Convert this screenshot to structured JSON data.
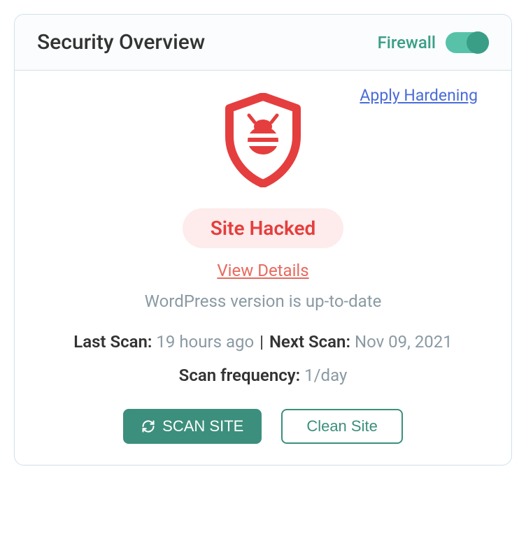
{
  "header": {
    "title": "Security Overview",
    "firewall_label": "Firewall",
    "firewall_on": true
  },
  "links": {
    "apply_hardening": "Apply Hardening",
    "view_details": "View Details"
  },
  "status": {
    "badge": "Site Hacked",
    "wp_version": "WordPress version is up-to-date"
  },
  "scan": {
    "last_label": "Last Scan:",
    "last_value": "19 hours ago",
    "next_label": "Next Scan:",
    "next_value": "Nov 09, 2021",
    "freq_label": "Scan frequency:",
    "freq_value": "1/day"
  },
  "buttons": {
    "scan": "SCAN SITE",
    "clean": "Clean Site"
  }
}
